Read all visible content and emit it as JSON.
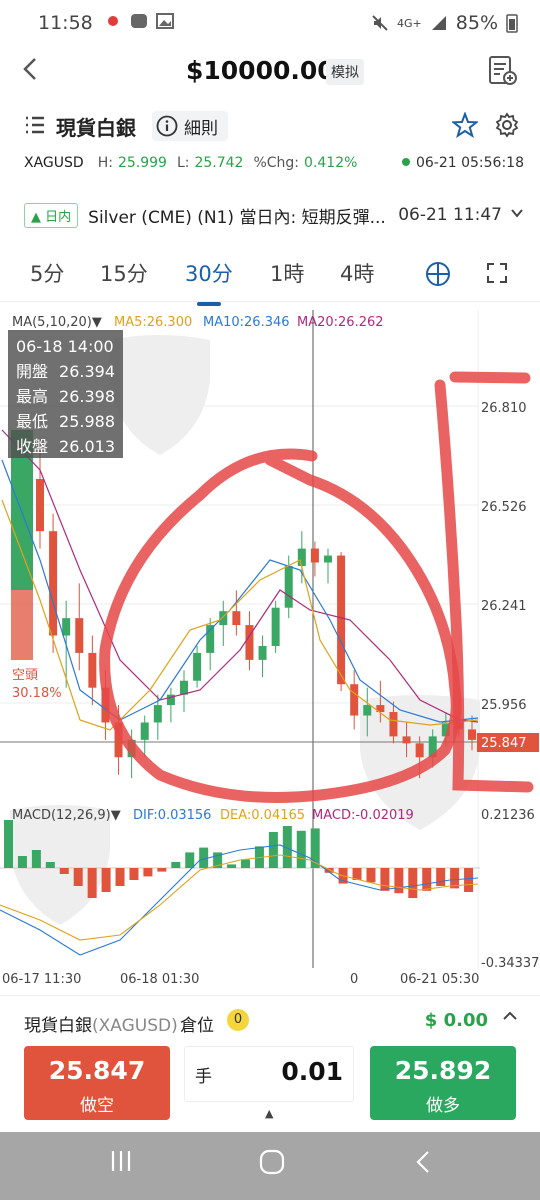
{
  "status": {
    "time": "11:58",
    "battery": "85%",
    "network": "4G+"
  },
  "header": {
    "title": "$10000.00",
    "badge": "模拟"
  },
  "symbol": {
    "name": "現貨白銀",
    "rules_label": "細則"
  },
  "quote": {
    "ticker": "XAGUSD",
    "high_label": "H:",
    "high": "25.999",
    "low_label": "L:",
    "low": "25.742",
    "chg_label": "%Chg:",
    "chg": "0.412%",
    "timestamp": "06-21 05:56:18"
  },
  "news": {
    "tag": "日内",
    "text": "Silver (CME) (N1) 當日內: 短期反彈...",
    "time": "06-21 11:47"
  },
  "tabs": [
    {
      "label": "5分"
    },
    {
      "label": "15分"
    },
    {
      "label": "30分"
    },
    {
      "label": "1時"
    },
    {
      "label": "4時"
    }
  ],
  "chart_labels": {
    "ma_legend": "MA(5,10,20)▼",
    "ma5": "MA5:26.300",
    "ma10": "MA10:26.346",
    "ma20": "MA20:26.262",
    "macd_legend": "MACD(12,26,9)▼",
    "dif": "DIF:0.03156",
    "dea": "DEA:0.04165",
    "macd": "MACD:-0.02019",
    "short_label": "空頭",
    "short_pct": "30.18%",
    "price_ticks": [
      "26.810",
      "26.526",
      "26.241",
      "25.956"
    ],
    "current_price": "25.847",
    "macd_ticks": [
      "0.21236",
      "-0.34337"
    ],
    "time_ticks": [
      "06-17 11:30",
      "06-18 01:30",
      "0",
      "06-21 05:30"
    ]
  },
  "tooltip": {
    "date": "06-18 14:00",
    "rows": [
      {
        "k": "開盤",
        "v": "26.394"
      },
      {
        "k": "最高",
        "v": "26.398"
      },
      {
        "k": "最低",
        "v": "25.988"
      },
      {
        "k": "收盤",
        "v": "26.013"
      }
    ]
  },
  "trade": {
    "product": "現貨白銀",
    "product_sub": "(XAGUSD)",
    "position_label": "倉位",
    "position_count": "0",
    "pnl": "$ 0.00",
    "sell_price": "25.847",
    "sell_label": "做空",
    "hand_label": "手",
    "quantity": "0.01",
    "buy_price": "25.892",
    "buy_label": "做多"
  },
  "chart_data": {
    "type": "candlestick",
    "price_axis": [
      25.956,
      26.241,
      26.526,
      26.81
    ],
    "candles": [
      [
        26.6,
        26.7,
        26.4,
        26.45
      ],
      [
        26.45,
        26.5,
        26.1,
        26.15
      ],
      [
        26.15,
        26.25,
        26.0,
        26.2
      ],
      [
        26.2,
        26.3,
        26.05,
        26.1
      ],
      [
        26.1,
        26.15,
        25.95,
        26.0
      ],
      [
        26.0,
        26.05,
        25.85,
        25.9
      ],
      [
        25.9,
        25.95,
        25.75,
        25.8
      ],
      [
        25.8,
        25.88,
        25.74,
        25.85
      ],
      [
        25.85,
        25.92,
        25.8,
        25.9
      ],
      [
        25.9,
        25.98,
        25.85,
        25.95
      ],
      [
        25.95,
        26.0,
        25.9,
        25.98
      ],
      [
        25.98,
        26.05,
        25.93,
        26.02
      ],
      [
        26.02,
        26.12,
        26.0,
        26.1
      ],
      [
        26.1,
        26.2,
        26.05,
        26.18
      ],
      [
        26.18,
        26.25,
        26.12,
        26.22
      ],
      [
        26.22,
        26.28,
        26.15,
        26.18
      ],
      [
        26.18,
        26.22,
        26.05,
        26.08
      ],
      [
        26.08,
        26.15,
        26.03,
        26.12
      ],
      [
        26.12,
        26.25,
        26.1,
        26.23
      ],
      [
        26.23,
        26.38,
        26.2,
        26.35
      ],
      [
        26.35,
        26.45,
        26.3,
        26.4
      ],
      [
        26.4,
        26.42,
        26.32,
        26.36
      ],
      [
        26.36,
        26.4,
        26.3,
        26.38
      ],
      [
        26.38,
        26.39,
        25.99,
        26.01
      ],
      [
        26.01,
        26.05,
        25.88,
        25.92
      ],
      [
        25.92,
        26.0,
        25.86,
        25.95
      ],
      [
        25.95,
        26.02,
        25.9,
        25.93
      ],
      [
        25.93,
        25.96,
        25.84,
        25.86
      ],
      [
        25.86,
        25.9,
        25.8,
        25.84
      ],
      [
        25.84,
        25.86,
        25.74,
        25.8
      ],
      [
        25.8,
        25.88,
        25.77,
        25.86
      ],
      [
        25.86,
        25.93,
        25.83,
        25.9
      ],
      [
        25.9,
        25.97,
        25.86,
        25.88
      ],
      [
        25.88,
        25.92,
        25.82,
        25.85
      ]
    ]
  }
}
